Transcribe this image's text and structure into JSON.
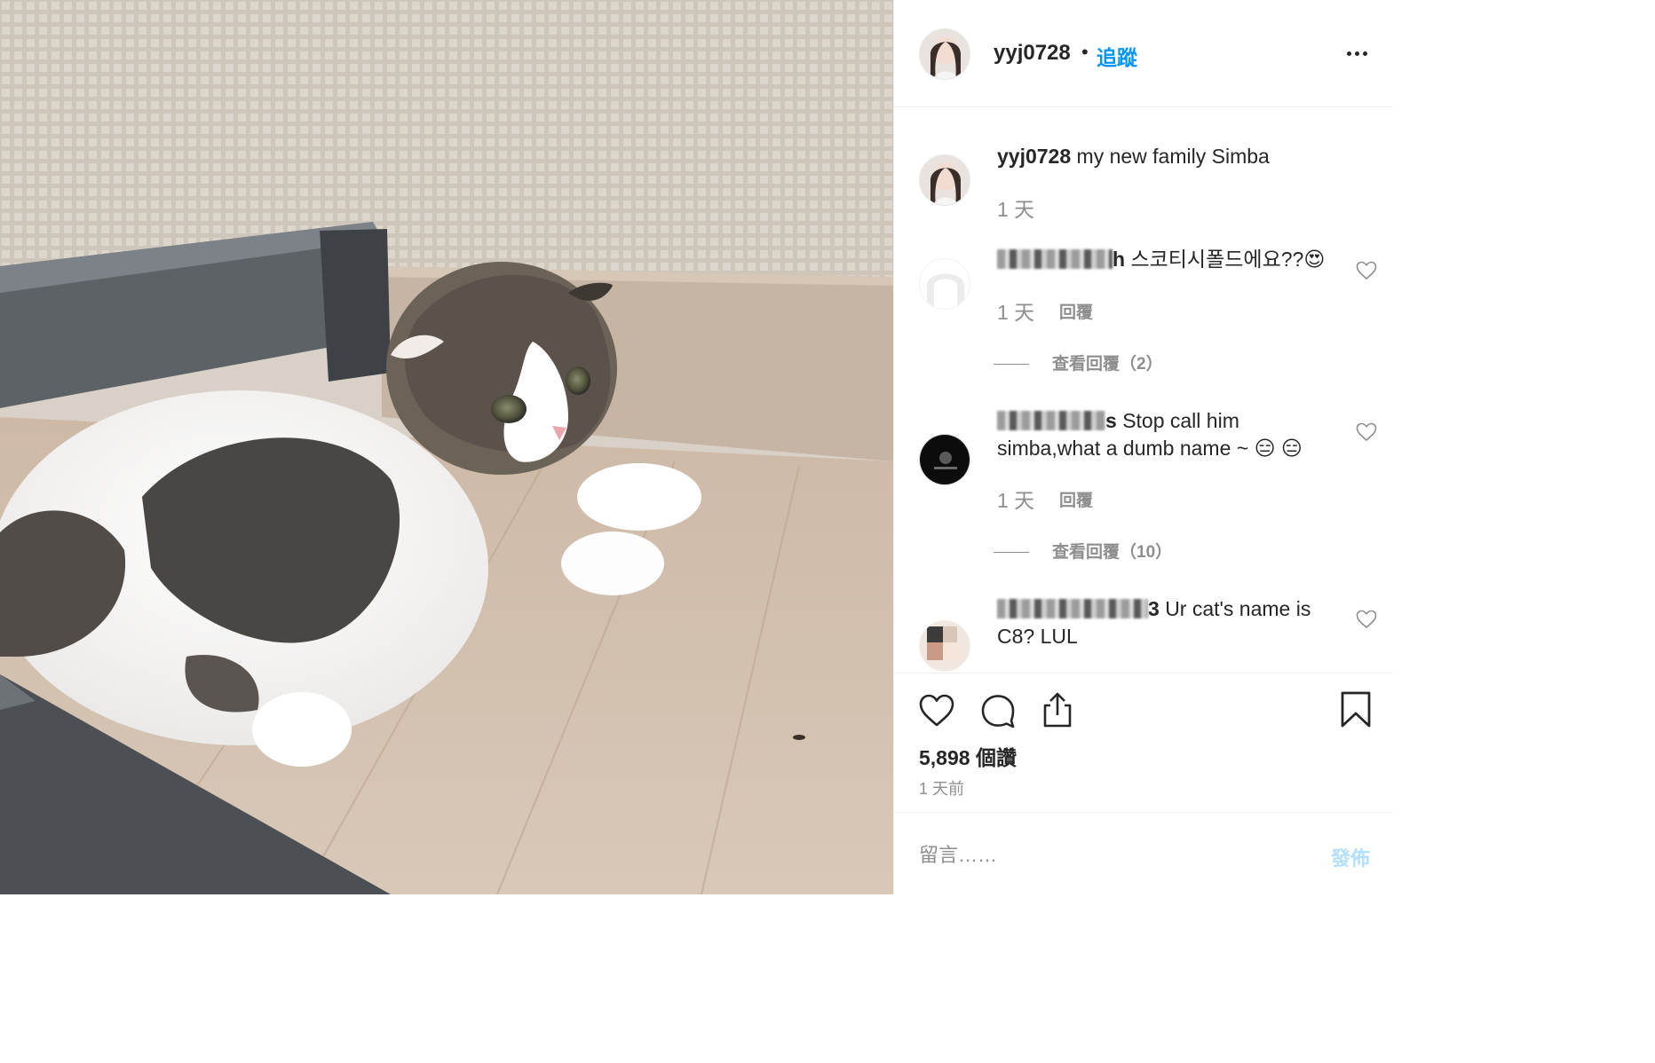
{
  "post": {
    "image_alt": "",
    "author": "yyj0728",
    "follow_label": "追蹤",
    "caption": {
      "username": "yyj0728",
      "text": "my new family Simba",
      "time": "1 天"
    }
  },
  "comments": [
    {
      "username_visible": "h",
      "text": "스코티시폴드에요??😍",
      "time": "1 天",
      "reply_label": "回覆",
      "view_replies": "查看回覆（2）"
    },
    {
      "username_visible": "s",
      "text_line1": "Stop call him",
      "text_line2": "simba,what a dumb name ~ 😑 😑",
      "time": "1 天",
      "reply_label": "回覆",
      "view_replies": "查看回覆（10）"
    },
    {
      "username_visible": "3",
      "text_line1": "Ur cat's name is",
      "text_line2": "C8? LUL"
    }
  ],
  "actions": {
    "likes": "5,898 個讚",
    "posted_time": "1 天前"
  },
  "composer": {
    "placeholder": "留言……",
    "post_label": "發佈"
  },
  "colors": {
    "accent": "#0095f6",
    "post_disabled": "#b2dffc",
    "secondary_text": "#8e8e8e",
    "divider": "#efefef"
  },
  "icons": {
    "more": "more-horizontal-icon",
    "like": "heart-icon",
    "comment": "comment-bubble-icon",
    "share": "share-upload-icon",
    "save": "bookmark-icon",
    "comment_like": "small-heart-icon"
  }
}
